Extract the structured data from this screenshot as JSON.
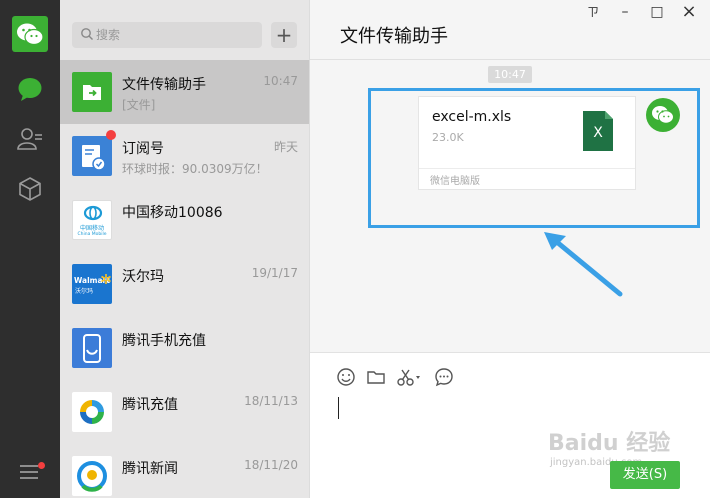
{
  "window": {
    "title": "文件传输助手",
    "controls": {
      "pin": "ㄗ",
      "minimize": "–",
      "maximize": "□",
      "close": "×"
    }
  },
  "search": {
    "placeholder": "搜索",
    "add_label": "+"
  },
  "chats": [
    {
      "name": "文件传输助手",
      "message": "[文件]",
      "time": "10:47",
      "active": true
    },
    {
      "name": "订阅号",
      "message": "环球时报：90.0309万亿！",
      "time": "昨天",
      "badge": true
    },
    {
      "name": "中国移动10086",
      "message": "",
      "time": "",
      "thumb_text": "中国移动",
      "thumb_sub": "China Mobile"
    },
    {
      "name": "沃尔玛",
      "message": "",
      "time": "19/1/17",
      "thumb_text": "Walmart",
      "thumb_sub": "沃尔玛"
    },
    {
      "name": "腾讯手机充值",
      "message": "",
      "time": ""
    },
    {
      "name": "腾讯充值",
      "message": "",
      "time": "18/11/13"
    },
    {
      "name": "腾讯新闻",
      "message": "",
      "time": "18/11/20"
    }
  ],
  "conversation": {
    "timestamp": "10:47",
    "file": {
      "name": "excel-m.xls",
      "size": "23.0K",
      "source": "微信电脑版",
      "type_letter": "X"
    }
  },
  "composer": {
    "send_label": "发送(S)",
    "watermark": "Baidu 经验",
    "watermark_sub": "jingyan.baidu.com"
  },
  "colors": {
    "nav_bg": "#2e2e2e",
    "wechat_green": "#3cb034",
    "highlight_blue": "#3aa0e6",
    "send_green": "#46b947",
    "excel_green": "#1f7244"
  }
}
